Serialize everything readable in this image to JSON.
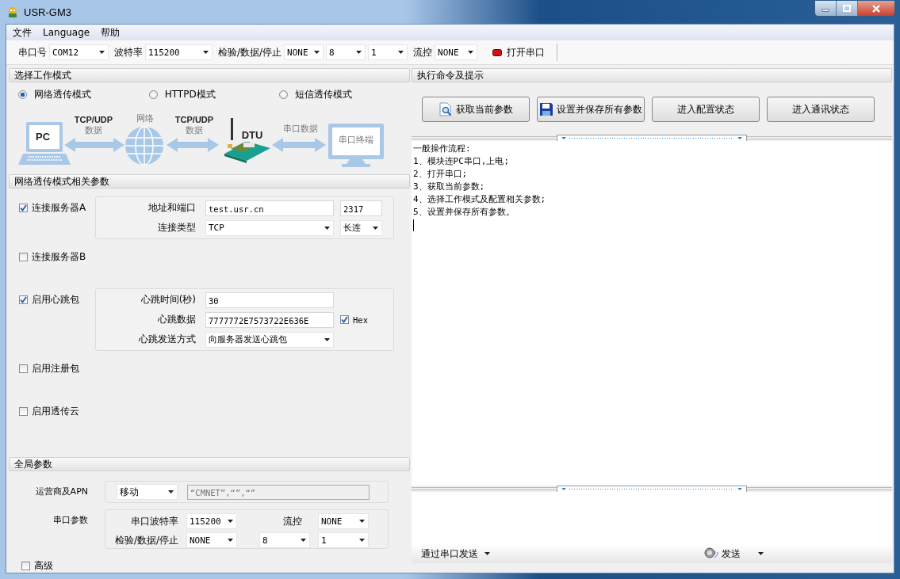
{
  "window": {
    "title": "USR-GM3"
  },
  "menu": [
    {
      "label": "文件"
    },
    {
      "label": "Language"
    },
    {
      "label": "帮助"
    }
  ],
  "toolbar": {
    "port": {
      "label": "串口号",
      "value": "COM12"
    },
    "baud": {
      "label": "波特率",
      "value": "115200"
    },
    "frame": {
      "label": "检验/数据/停止",
      "values": [
        "NONE",
        "8",
        "1"
      ]
    },
    "flow": {
      "label": "流控",
      "value": "NONE"
    },
    "open_button": {
      "label": "打开串口"
    }
  },
  "mode_section": {
    "title": "选择工作模式",
    "modes": [
      {
        "label": "网络透传模式",
        "selected": true
      },
      {
        "label": "HTTPD模式",
        "selected": false
      },
      {
        "label": "短信透传模式",
        "selected": false
      }
    ],
    "diagram": {
      "pc": "PC",
      "link1": [
        "TCP/UDP",
        "数据"
      ],
      "network": "网络",
      "link2": [
        "TCP/UDP",
        "数据"
      ],
      "dtu": "DTU",
      "link3": "串口数据",
      "terminal": "串口终端"
    }
  },
  "net_section": {
    "title": "网络透传模式相关参数",
    "groups": [
      {
        "label": "连接服务器A",
        "checked": true,
        "rows": [
          {
            "label": "地址和端口",
            "fields": [
              {
                "kind": "input",
                "value": "test.usr.cn"
              },
              {
                "kind": "input",
                "value": "2317"
              }
            ]
          },
          {
            "label": "连接类型",
            "fields": [
              {
                "kind": "select",
                "value": "TCP"
              },
              {
                "kind": "select",
                "value": "长连"
              }
            ]
          }
        ]
      },
      {
        "label": "连接服务器B",
        "checked": false
      },
      {
        "label": "启用心跳包",
        "checked": true,
        "rows": [
          {
            "label": "心跳时间(秒)",
            "fields": [
              {
                "kind": "input",
                "value": "30"
              }
            ]
          },
          {
            "label": "心跳数据",
            "fields": [
              {
                "kind": "input",
                "value": "7777772E7573722E636E"
              },
              {
                "kind": "checkbox",
                "label": "Hex",
                "checked": true
              }
            ]
          },
          {
            "label": "心跳发送方式",
            "fields": [
              {
                "kind": "select",
                "value": "向服务器发送心跳包"
              }
            ]
          }
        ]
      },
      {
        "label": "启用注册包",
        "checked": false
      },
      {
        "label": "启用透传云",
        "checked": false
      }
    ]
  },
  "global_section": {
    "title": "全局参数",
    "apn": {
      "label": "运营商及APN",
      "carrier": "移动",
      "value": "“CMNET”,“”,“”",
      "disabled": true
    },
    "serial": {
      "label": "串口参数",
      "rows": [
        {
          "fields": [
            {
              "kind": "label",
              "text": "串口波特率"
            },
            {
              "kind": "select",
              "value": "115200"
            },
            {
              "kind": "label",
              "text": "流控"
            },
            {
              "kind": "select",
              "value": "NONE"
            }
          ]
        },
        {
          "fields": [
            {
              "kind": "label",
              "text": "检验/数据/停止"
            },
            {
              "kind": "select",
              "value": "NONE"
            },
            {
              "kind": "select",
              "value": "8"
            },
            {
              "kind": "select",
              "value": "1"
            }
          ]
        }
      ]
    },
    "advanced": {
      "label": "高级",
      "checked": false
    }
  },
  "right_panel": {
    "title": "执行命令及提示",
    "buttons": [
      {
        "label": "获取当前参数"
      },
      {
        "label": "设置并保存所有参数"
      },
      {
        "label": "进入配置状态"
      },
      {
        "label": "进入通讯状态"
      }
    ],
    "log": [
      "一般操作流程:",
      "1、模块连PC串口,上电;",
      "2、打开串口;",
      "3、获取当前参数;",
      "4、选择工作模式及配置相关参数;",
      "5、设置并保存所有参数。"
    ],
    "send_via": "通过串口发送",
    "send": "发送"
  }
}
